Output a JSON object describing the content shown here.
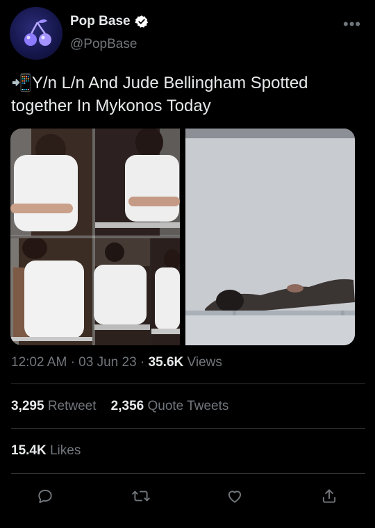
{
  "account": {
    "name": "Pop Base",
    "handle": "@PopBase",
    "verified": true
  },
  "tweet": {
    "emoji": "📲",
    "text": "Y/n L/n And Jude Bellingham Spotted together In Mykonos Today"
  },
  "meta": {
    "time": "12:02 AM",
    "date": "03 Jun 23",
    "views_count": "35.6K",
    "views_label": "Views"
  },
  "stats": {
    "retweets_count": "3,295",
    "retweets_label": "Retweet",
    "quotes_count": "2,356",
    "quotes_label": "Quote Tweets",
    "likes_count": "15.4K",
    "likes_label": "Likes"
  },
  "actions": [
    "reply-icon",
    "retweet-icon",
    "like-icon",
    "share-icon"
  ],
  "colors": {
    "background": "#000000",
    "text": "#e7e9ea",
    "secondary": "#71767b",
    "verified": "#ffffff",
    "divider": "#2f3336"
  }
}
